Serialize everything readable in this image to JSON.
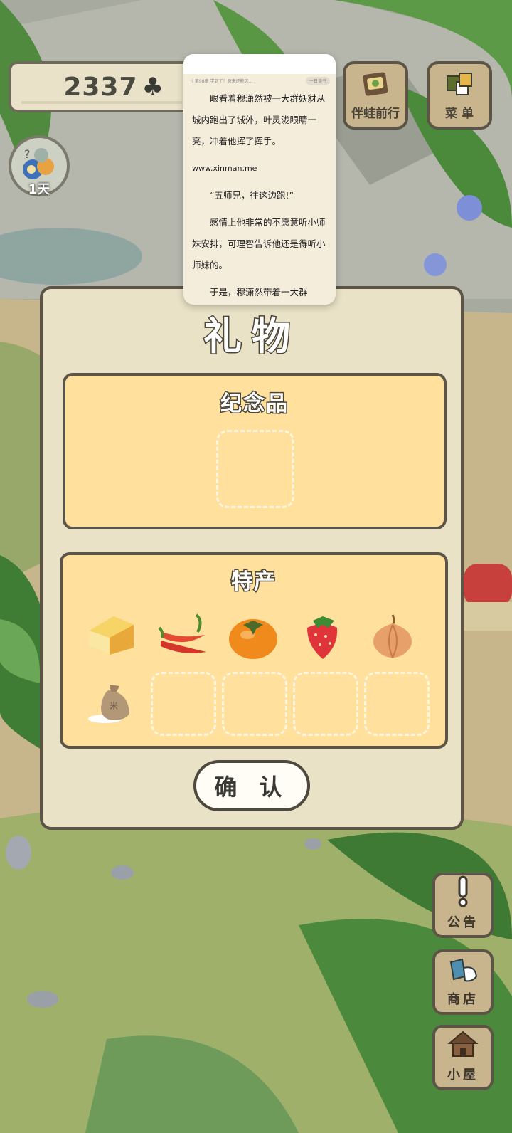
{
  "hud": {
    "clover_count": "2337",
    "clover_symbol": "♣",
    "frog_days": "1天"
  },
  "top_buttons": {
    "travel_label": "伴蛙前行",
    "menu_label": "菜 单"
  },
  "reader": {
    "header_left": "〈 第98章 学到了！原来还能这…",
    "header_pill": "一日读书",
    "paragraphs": [
      "眼看着穆潇然被一大群妖豺从城内跑出了城外，叶灵泷眼睛一亮，冲着他挥了挥手。",
      "“五师兄，往这边跑!”",
      "感情上他非常的不愿意听小师妹安排，可理智告诉他还是得听小师妹的。",
      "于是，穆潇然带着一大群"
    ],
    "url": "www.xinman.me"
  },
  "gift_panel": {
    "title": "礼物",
    "souvenir_label": "纪念品",
    "specialty_label": "特产",
    "specialty_items": [
      "cheese-icon",
      "chili-pepper-icon",
      "persimmon-icon",
      "strawberry-icon",
      "onion-icon",
      "rice-sack-icon"
    ],
    "confirm_label": "确 认"
  },
  "side_buttons": {
    "notice_label": "公告",
    "shop_label": "商店",
    "house_label": "小屋"
  },
  "colors": {
    "panel_bg": "#e9e2c6",
    "box_bg": "#ffe09c",
    "button_wood": "#c9b58d",
    "outline": "#5b5447"
  }
}
